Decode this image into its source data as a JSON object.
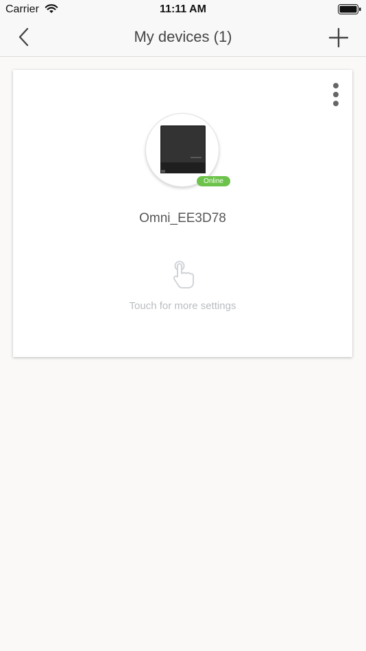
{
  "status_bar": {
    "carrier": "Carrier",
    "time": "11:11 AM",
    "wifi_icon": "wifi-icon",
    "battery_icon": "battery-icon"
  },
  "nav": {
    "title": "My devices (1)",
    "back_icon": "chevron-left-icon",
    "add_icon": "plus-icon"
  },
  "device_card": {
    "name": "Omni_EE3D78",
    "status": "Online",
    "status_color": "#6cc24a",
    "hint": "Touch for more settings",
    "more_icon": "more-vertical-icon",
    "hint_icon": "touch-hand-icon"
  },
  "colors": {
    "background": "#faf9f8",
    "card": "#ffffff",
    "hint_text": "#b8bcc0"
  }
}
